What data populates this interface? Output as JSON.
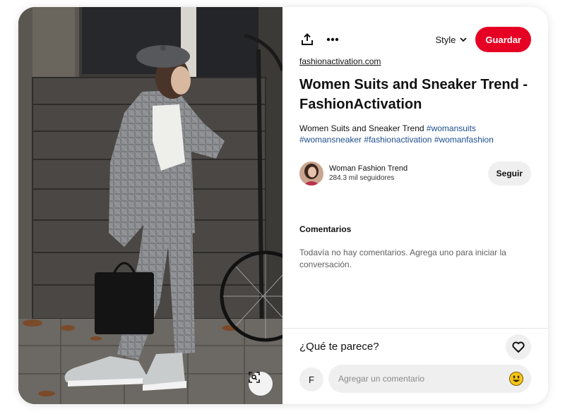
{
  "pin": {
    "image_alt": "Woman in grey plaid suit with beret and sneakers standing on stone steps",
    "source_domain": "fashionactivation.com",
    "title": "Women Suits and Sneaker Trend - FashionActivation",
    "description_text": "Women Suits and Sneaker Trend",
    "hashtags": [
      "#womansuits",
      "#womansneaker",
      "#fashionactivation",
      "#womanfashion"
    ]
  },
  "toolbar": {
    "share_icon": "share-icon",
    "more_icon": "more-icon",
    "board_label": "Style",
    "save_label": "Guardar",
    "accent_color": "#e60023"
  },
  "creator": {
    "name": "Woman Fashion Trend",
    "followers": "284.3 mil seguidores",
    "follow_label": "Seguir"
  },
  "comments": {
    "heading": "Comentarios",
    "empty_message": "Todavía no hay comentarios. Agrega uno para iniciar la conversación."
  },
  "composer": {
    "prompt": "¿Qué te parece?",
    "user_initial": "F",
    "placeholder": "Agregar un comentario"
  }
}
